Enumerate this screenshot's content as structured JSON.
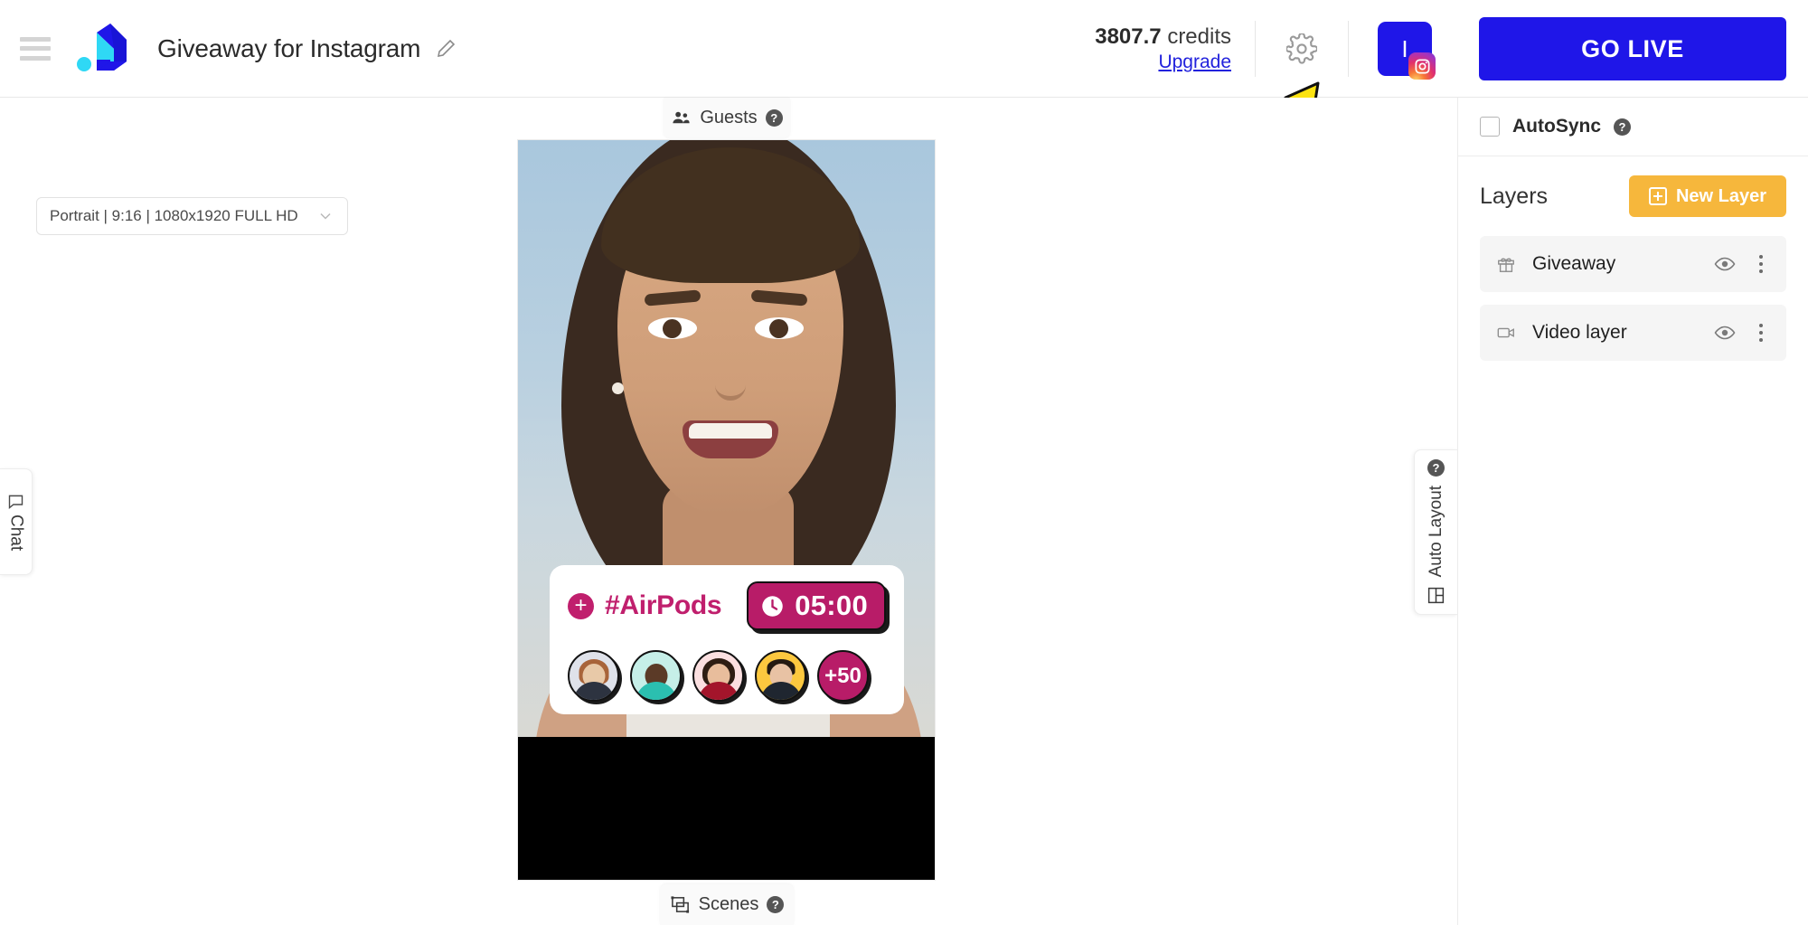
{
  "header": {
    "menu_icon": "hamburger-menu-icon",
    "logo_icon": "app-logo-icon",
    "title": "Giveaway for Instagram",
    "edit_icon": "pencil-icon",
    "credits_amount": "3807.7",
    "credits_label": "credits",
    "upgrade_label": "Upgrade",
    "settings_icon": "gear-icon",
    "avatar_letter": "I",
    "avatar_platform_icon": "instagram-icon",
    "go_live_label": "GO LIVE"
  },
  "annotation": {
    "arrow_icon": "yellow-curved-arrow-icon"
  },
  "workspace": {
    "ratio_select": {
      "value": "Portrait | 9:16 | 1080x1920 FULL HD",
      "chevron_icon": "chevron-down-icon"
    },
    "chat_tab": {
      "label": "Chat",
      "icon": "chat-bubble-icon"
    },
    "guests_tab": {
      "label": "Guests",
      "icon": "people-group-icon",
      "help": "?"
    },
    "scenes_tab": {
      "label": "Scenes",
      "icon": "scenes-frame-icon",
      "help": "?"
    },
    "auto_layout_tab": {
      "label": "Auto Layout",
      "icon": "layout-grid-icon",
      "help": "?"
    }
  },
  "giveaway_widget": {
    "plus_icon": "plus-circle-icon",
    "hashtag": "#AirPods",
    "clock_icon": "clock-icon",
    "timer": "05:00",
    "more_count": "+50",
    "accent_color": "#b81c68",
    "participants": [
      {
        "name": "participant-1"
      },
      {
        "name": "participant-2"
      },
      {
        "name": "participant-3"
      },
      {
        "name": "participant-4"
      }
    ]
  },
  "right_panel": {
    "autosync": {
      "label": "AutoSync",
      "help": "?",
      "checked": false
    },
    "layers_title": "Layers",
    "new_layer_label": "New Layer",
    "new_layer_color": "#f6b73c",
    "layers": [
      {
        "name": "Giveaway",
        "icon": "gift-icon",
        "visibility_icon": "eye-icon",
        "menu_icon": "three-dots-icon"
      },
      {
        "name": "Video layer",
        "icon": "video-camera-icon",
        "visibility_icon": "eye-icon",
        "menu_icon": "three-dots-icon"
      }
    ]
  }
}
